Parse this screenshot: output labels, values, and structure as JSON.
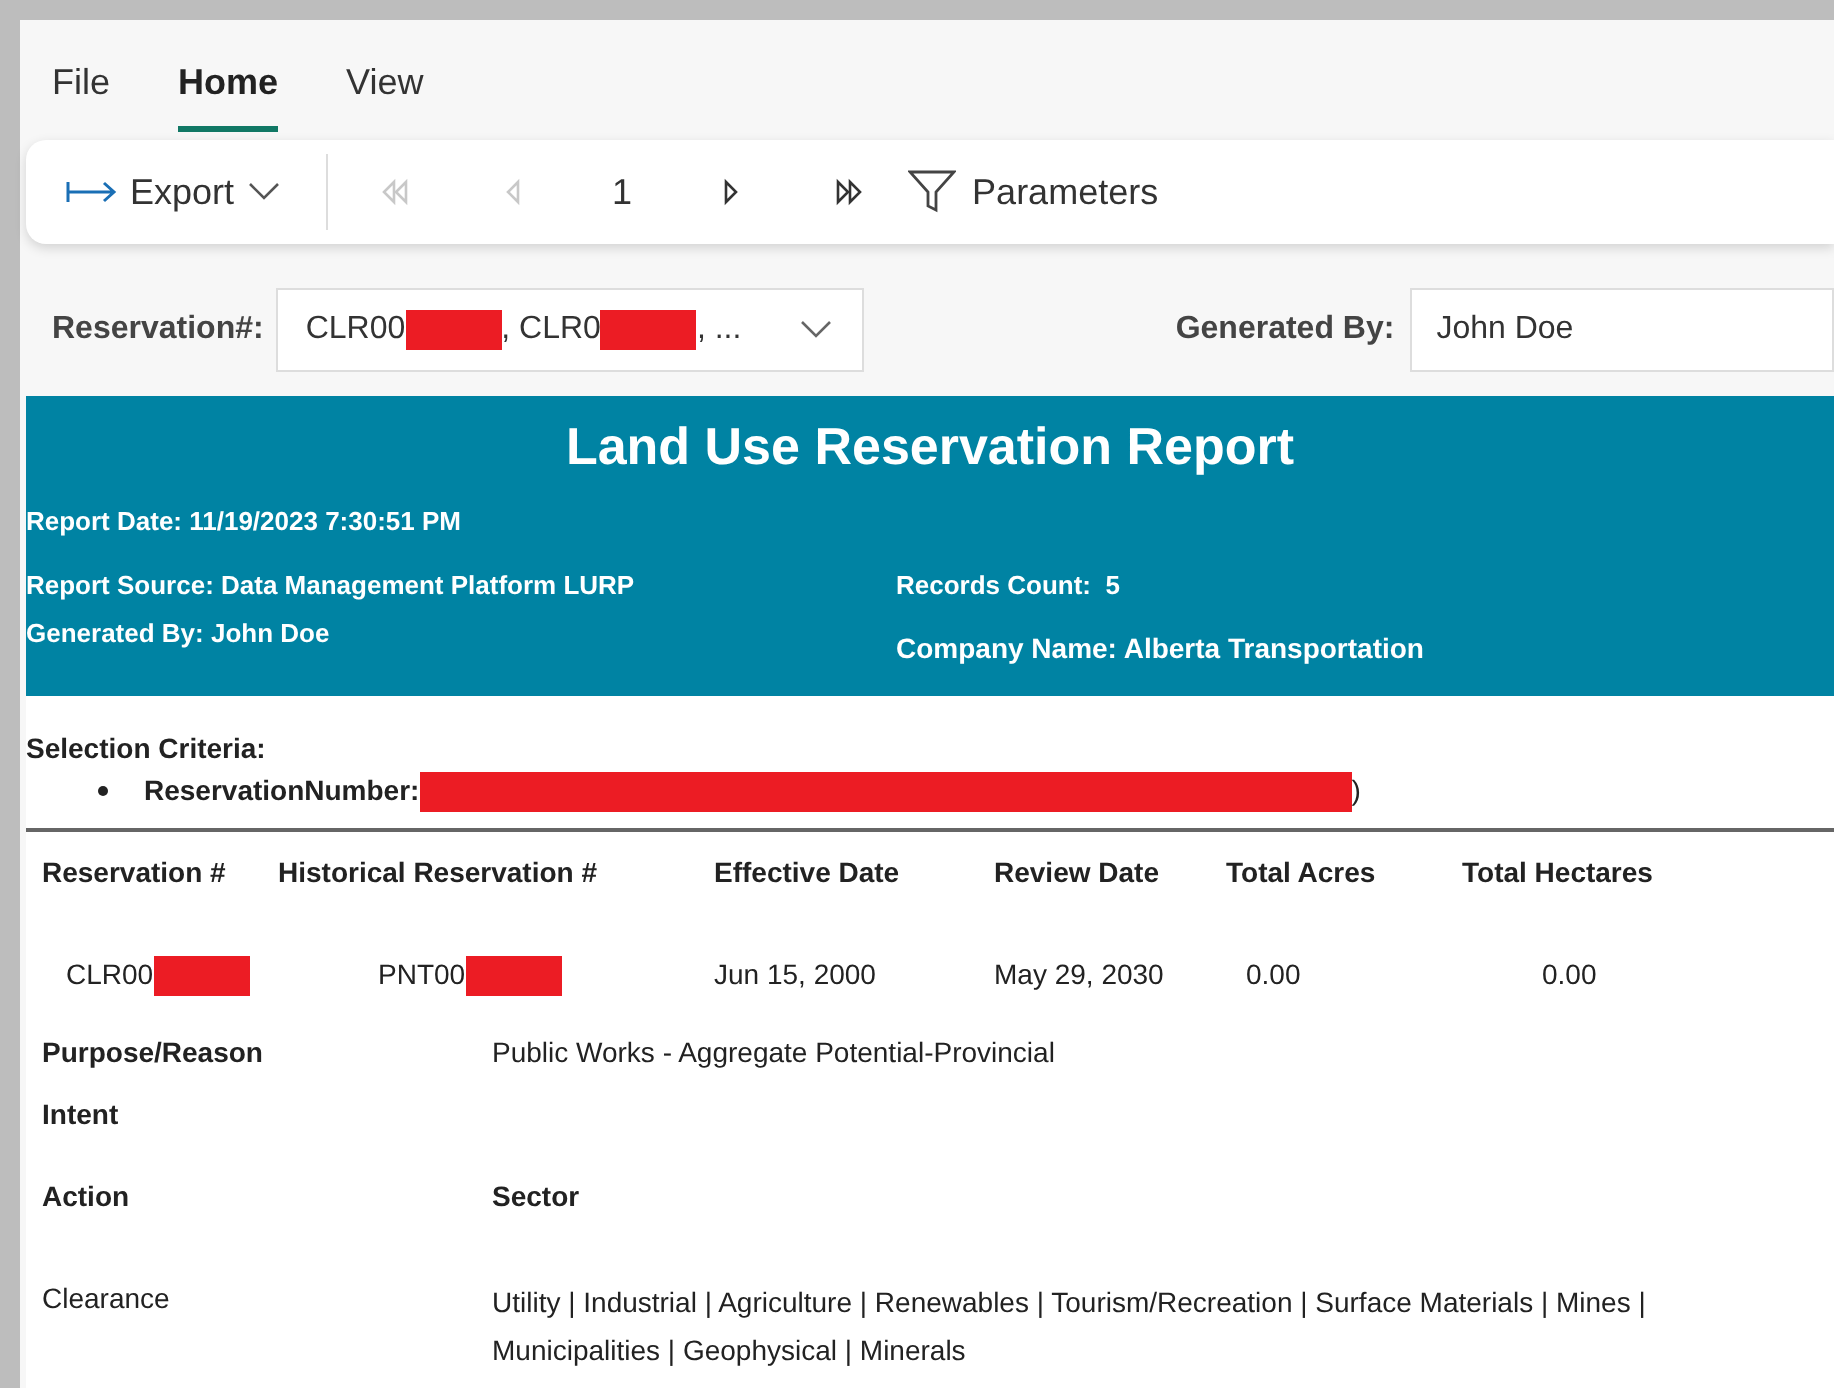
{
  "menu_tabs": [
    {
      "label": "File",
      "selected": false
    },
    {
      "label": "Home",
      "selected": true
    },
    {
      "label": "View",
      "selected": false
    }
  ],
  "toolbar": {
    "export": "Export",
    "first_disabled": true,
    "previous_disabled": true,
    "page": "1",
    "next_disabled": false,
    "last_disabled": false,
    "parameters": "Parameters"
  },
  "filters": {
    "reservation_label": "Reservation#:",
    "reservation_value": [
      {
        "kind": "text",
        "text": "CLR00"
      },
      {
        "kind": "redacted"
      },
      {
        "kind": "text",
        "text": ", CLR0"
      },
      {
        "kind": "redacted"
      },
      {
        "kind": "text",
        "text": ", ..."
      }
    ],
    "generated_label": "Generated By:",
    "generated_value": "John Doe"
  },
  "report": {
    "title": "Land Use Reservation Report",
    "report_date": "Report Date: 11/19/2023 7:30:51 PM",
    "report_source": "Report Source: Data Management Platform LURP",
    "generated_by": "Generated By: John Doe",
    "records_count": "Records Count:  5",
    "company_name": "Company Name: Alberta Transportation",
    "selection_label": "Selection Criteria:",
    "criteria": [
      {
        "label": "ReservationNumber:",
        "value": [
          {
            "kind": "redacted_long"
          },
          {
            "kind": "text",
            "text": ")"
          }
        ]
      }
    ]
  },
  "table": {
    "columns": [
      "Reservation #",
      "Historical Reservation #",
      "Effective Date",
      "Review Date",
      "Total Acres",
      "Total Hectares"
    ],
    "rows": [
      {
        "cells": [
          [
            {
              "kind": "text",
              "text": "CLR00"
            },
            {
              "kind": "redacted"
            }
          ],
          [
            {
              "kind": "text",
              "text": "PNT00"
            },
            {
              "kind": "redacted"
            }
          ],
          [
            {
              "kind": "text",
              "text": "Jun 15, 2000"
            }
          ],
          [
            {
              "kind": "text",
              "text": "May 29, 2030"
            }
          ],
          [
            {
              "kind": "text",
              "text": "0.00"
            }
          ],
          [
            {
              "kind": "text",
              "text": "0.00"
            }
          ]
        ]
      }
    ]
  },
  "details": {
    "purpose_label": "Purpose/Reason",
    "purpose_value": "Public Works - Aggregate Potential-Provincial",
    "intent_label": "Intent",
    "action_label": "Action",
    "sector_label": "Sector",
    "action_value": "Clearance",
    "sector_value": "Utility | Industrial | Agriculture | Renewables | Tourism/Recreation | Surface Materials | Mines | Municipalities | Geophysical | Minerals"
  }
}
